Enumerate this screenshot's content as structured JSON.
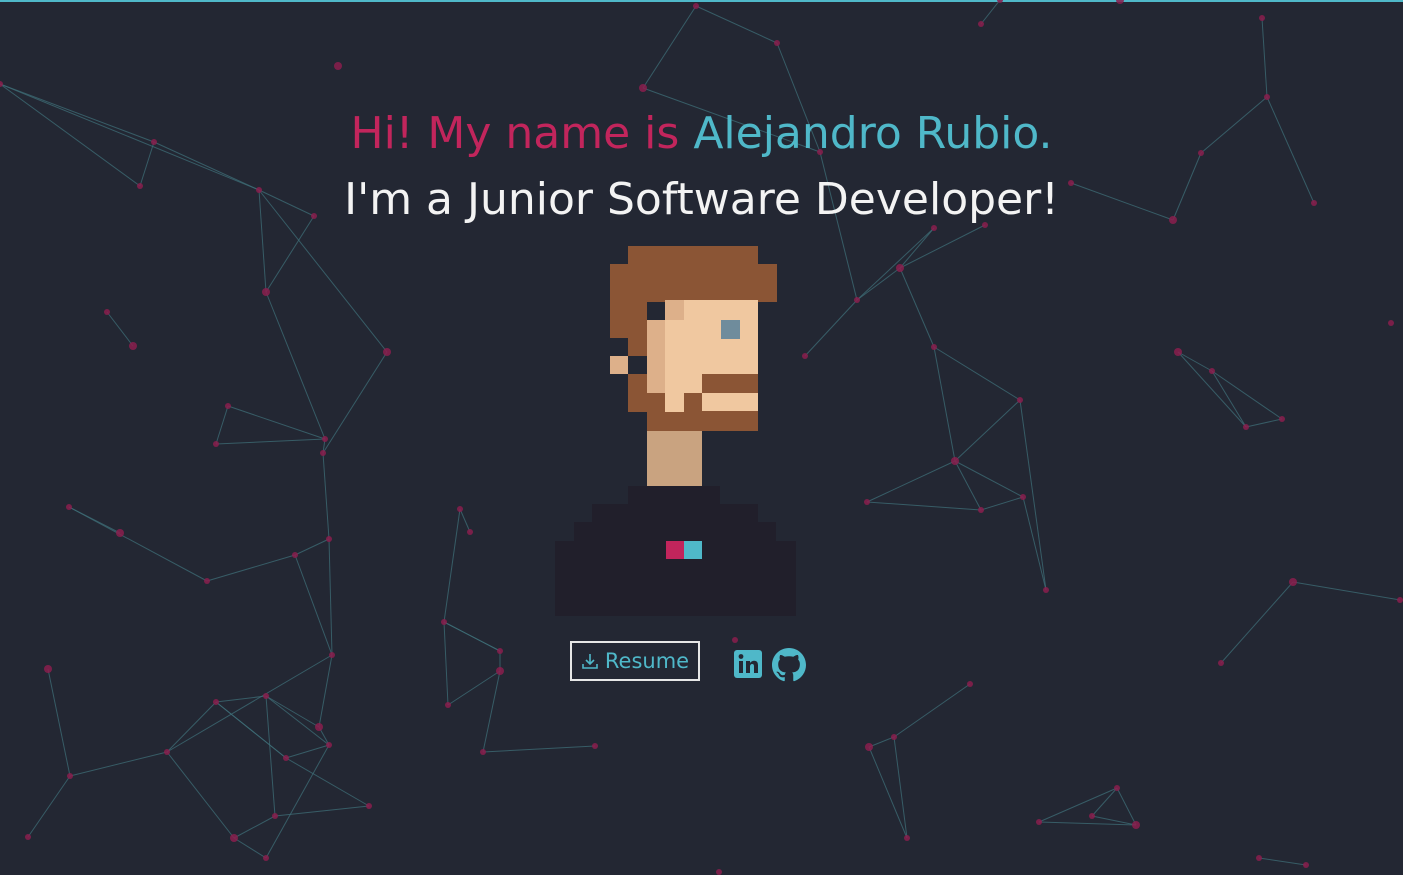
{
  "hero": {
    "greeting": "Hi! My name is ",
    "name": "Alejandro Rubio.",
    "tagline": "I'm a Junior Software Developer!"
  },
  "actions": {
    "resume_label": "Resume",
    "resume_icon": "download-icon",
    "social_icons": [
      "linkedin-icon",
      "github-icon"
    ]
  },
  "colors": {
    "background": "#232733",
    "accent_pink": "#c2255c",
    "accent_teal": "#4fb8c9",
    "text_light": "#f3f3f3"
  }
}
